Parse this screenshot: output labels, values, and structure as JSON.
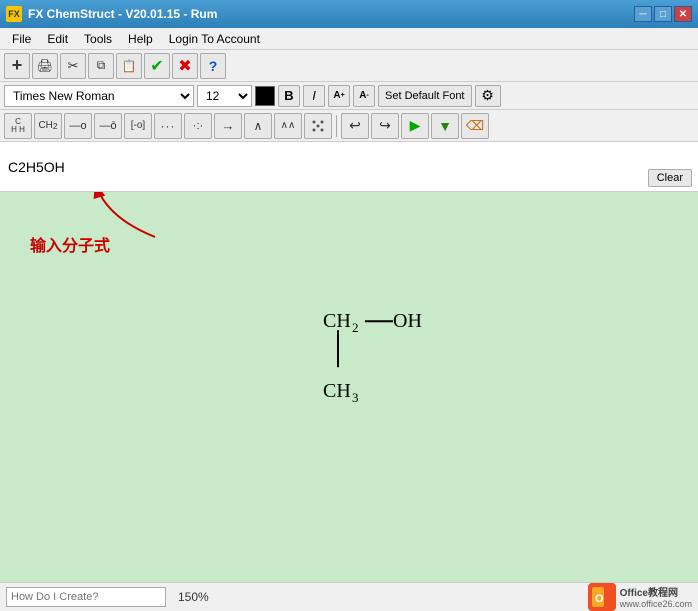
{
  "titlebar": {
    "title": "FX ChemStruct - V20.01.15 - Rum",
    "icon_label": "FX"
  },
  "menubar": {
    "items": [
      "File",
      "Edit",
      "Tools",
      "Help",
      "Login To Account"
    ]
  },
  "toolbar1": {
    "buttons": [
      {
        "name": "add",
        "label": "+",
        "title": "Add"
      },
      {
        "name": "print",
        "label": "🖨",
        "title": "Print"
      },
      {
        "name": "cut",
        "label": "✂",
        "title": "Cut"
      },
      {
        "name": "copy",
        "label": "📋",
        "title": "Copy"
      },
      {
        "name": "paste",
        "label": "📄",
        "title": "Paste"
      },
      {
        "name": "check",
        "label": "✔",
        "title": "OK",
        "color": "green"
      },
      {
        "name": "cancel",
        "label": "✖",
        "title": "Cancel",
        "color": "red"
      },
      {
        "name": "help",
        "label": "?",
        "title": "Help",
        "color": "blue"
      }
    ]
  },
  "toolbar2": {
    "font_name": "Times New Roman",
    "font_size": "12",
    "bold_label": "B",
    "italic_label": "I",
    "superscript_label": "A",
    "subscript_label": "A",
    "set_font_label": "Set Default Font",
    "settings_icon": "⚙"
  },
  "toolbar3": {
    "buttons": [
      {
        "name": "ch",
        "label": "CH",
        "sub": "H H",
        "active": false
      },
      {
        "name": "ch2",
        "label": "CH₂",
        "active": false
      },
      {
        "name": "bond-o",
        "label": "—o",
        "active": false
      },
      {
        "name": "bond-o2",
        "label": "—o̅",
        "active": false
      },
      {
        "name": "bond-io",
        "label": "[-o]",
        "active": false
      },
      {
        "name": "dots3",
        "label": "···",
        "active": false
      },
      {
        "name": "dots2",
        "label": "·:·",
        "active": false
      },
      {
        "name": "arrow-right",
        "label": "→",
        "active": false
      },
      {
        "name": "wave1",
        "label": "∧",
        "active": false
      },
      {
        "name": "wave2",
        "label": "∧∧",
        "active": false
      },
      {
        "name": "dots-pattern",
        "label": "::",
        "active": false
      },
      {
        "name": "undo",
        "label": "↩",
        "active": false
      },
      {
        "name": "redo",
        "label": "↪",
        "active": false
      },
      {
        "name": "arrow-green",
        "label": "▶",
        "active": false
      },
      {
        "name": "arrow-down-green",
        "label": "▼",
        "active": false
      },
      {
        "name": "eraser",
        "label": "⌫",
        "active": false
      }
    ]
  },
  "input": {
    "value": "C2H5OH",
    "placeholder": ""
  },
  "clear_button": "Clear",
  "annotation": {
    "text": "输入分子式"
  },
  "structure": {
    "ch2": "CH",
    "ch2_sub": "2",
    "oh": "OH",
    "ch3": "CH",
    "ch3_sub": "3"
  },
  "statusbar": {
    "how_create_placeholder": "How Do I Create?",
    "zoom": "150%",
    "office_label": "Office教程网",
    "office_url": "www.office26.com"
  }
}
